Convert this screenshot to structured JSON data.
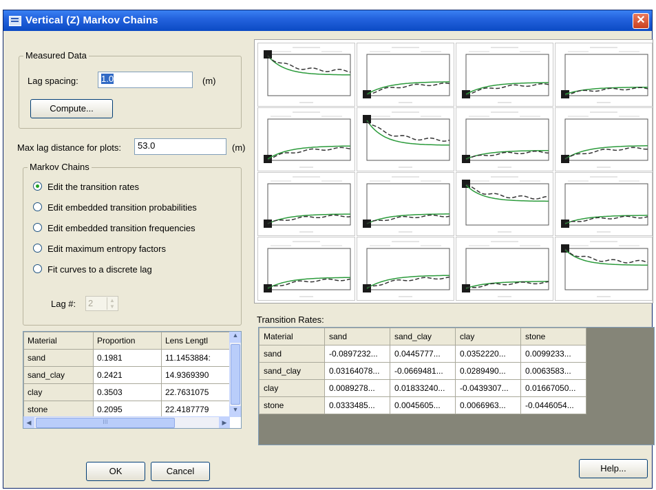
{
  "window": {
    "title": "Vertical (Z) Markov Chains",
    "close_glyph": "✕"
  },
  "measured": {
    "legend": "Measured Data",
    "lag_spacing_label": "Lag spacing:",
    "lag_spacing_value": "1.0",
    "lag_unit": "(m)",
    "compute_label": "Compute..."
  },
  "maxlag": {
    "label": "Max lag distance for plots:",
    "value": "53.0",
    "unit": "(m)"
  },
  "markov": {
    "legend": "Markov Chains",
    "options": [
      {
        "label": "Edit the transition rates",
        "selected": true
      },
      {
        "label": "Edit embedded transition probabilities",
        "selected": false
      },
      {
        "label": "Edit embedded transition frequencies",
        "selected": false
      },
      {
        "label": "Edit maximum entropy factors",
        "selected": false
      },
      {
        "label": "Fit curves to a discrete lag",
        "selected": false
      }
    ],
    "lag_label": "Lag #:",
    "lag_value": "2"
  },
  "material_table": {
    "headers": [
      "Material",
      "Proportion",
      "Lens Lengtl"
    ],
    "rows": [
      [
        "sand",
        "0.1981",
        "11.1453884:"
      ],
      [
        "sand_clay",
        "0.2421",
        "14.9369390"
      ],
      [
        "clay",
        "0.3503",
        "22.7631075"
      ],
      [
        "stone",
        "0.2095",
        "22.4187779"
      ]
    ],
    "scroll_text": "III"
  },
  "transition": {
    "label": "Transition Rates:",
    "headers": [
      "Material",
      "sand",
      "sand_clay",
      "clay",
      "stone"
    ],
    "rows": [
      [
        "sand",
        "-0.0897232...",
        "0.0445777...",
        "0.0352220...",
        "0.0099233..."
      ],
      [
        "sand_clay",
        "0.03164078...",
        "-0.0669481...",
        "0.0289490...",
        "0.0063583..."
      ],
      [
        "clay",
        "0.0089278...",
        "0.01833240...",
        "-0.0439307...",
        "0.01667050..."
      ],
      [
        "stone",
        "0.0333485...",
        "0.0045605...",
        "0.0066963...",
        "-0.0446054..."
      ]
    ]
  },
  "buttons": {
    "ok": "OK",
    "cancel": "Cancel",
    "help": "Help..."
  },
  "colors": {
    "model_curve": "#2a9a3a",
    "measured_curve": "#333333",
    "title_bar": "#2463de",
    "close": "#d2532e"
  }
}
